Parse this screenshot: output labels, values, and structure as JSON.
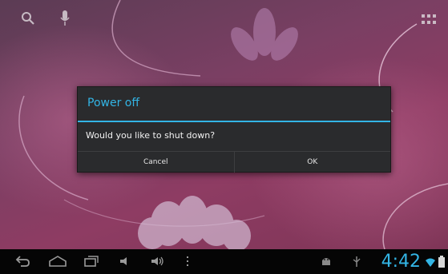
{
  "dialog": {
    "title": "Power off",
    "message": "Would you like to shut down?",
    "cancel_label": "Cancel",
    "ok_label": "OK"
  },
  "status_bar": {
    "time": "4:42"
  },
  "icons": {
    "top": [
      "search-icon",
      "microphone-icon",
      "all-apps-icon"
    ],
    "navigation": [
      "back-icon",
      "home-icon",
      "recent-apps-icon",
      "volume-down-icon",
      "volume-up-icon",
      "menu-icon"
    ],
    "status": [
      "android-debug-icon",
      "usb-icon",
      "wifi-icon",
      "battery-icon"
    ]
  },
  "colors": {
    "accent": "#33b5e5",
    "dialog_background": "#2a2b2d",
    "navbar_background": "#050505",
    "wallpaper": "#8e3c63"
  }
}
